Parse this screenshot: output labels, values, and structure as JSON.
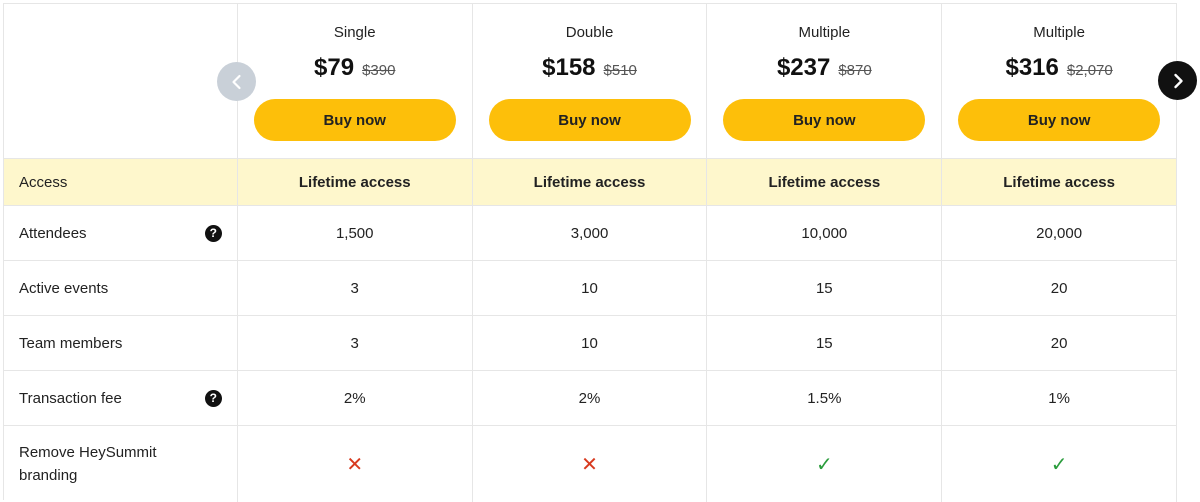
{
  "plans": [
    {
      "name": "Single",
      "price": "$79",
      "old_price": "$390",
      "buy_label": "Buy now"
    },
    {
      "name": "Double",
      "price": "$158",
      "old_price": "$510",
      "buy_label": "Buy now"
    },
    {
      "name": "Multiple",
      "price": "$237",
      "old_price": "$870",
      "buy_label": "Buy now"
    },
    {
      "name": "Multiple",
      "price": "$316",
      "old_price": "$2,070",
      "buy_label": "Buy now"
    }
  ],
  "access": {
    "label": "Access",
    "values": [
      "Lifetime access",
      "Lifetime access",
      "Lifetime access",
      "Lifetime access"
    ]
  },
  "features": [
    {
      "label": "Attendees",
      "help": "?",
      "values": [
        "1,500",
        "3,000",
        "10,000",
        "20,000"
      ]
    },
    {
      "label": "Active events",
      "help": "",
      "values": [
        "3",
        "10",
        "15",
        "20"
      ]
    },
    {
      "label": "Team members",
      "help": "",
      "values": [
        "3",
        "10",
        "15",
        "20"
      ]
    },
    {
      "label": "Transaction fee",
      "help": "?",
      "values": [
        "2%",
        "2%",
        "1.5%",
        "1%"
      ]
    }
  ],
  "branding": {
    "label": "Remove HeySummit branding",
    "marks": [
      "✕",
      "✕",
      "✓",
      "✓"
    ],
    "icons": [
      "cross-icon",
      "cross-icon",
      "check-icon",
      "check-icon"
    ]
  },
  "nav": {
    "prev_icon": "chevron-left-icon",
    "next_icon": "chevron-right-icon"
  },
  "colors": {
    "accent": "#fdbf0a",
    "access_row_bg": "#fef7cc",
    "cross": "#d83a1f",
    "check": "#2a9c3c"
  }
}
